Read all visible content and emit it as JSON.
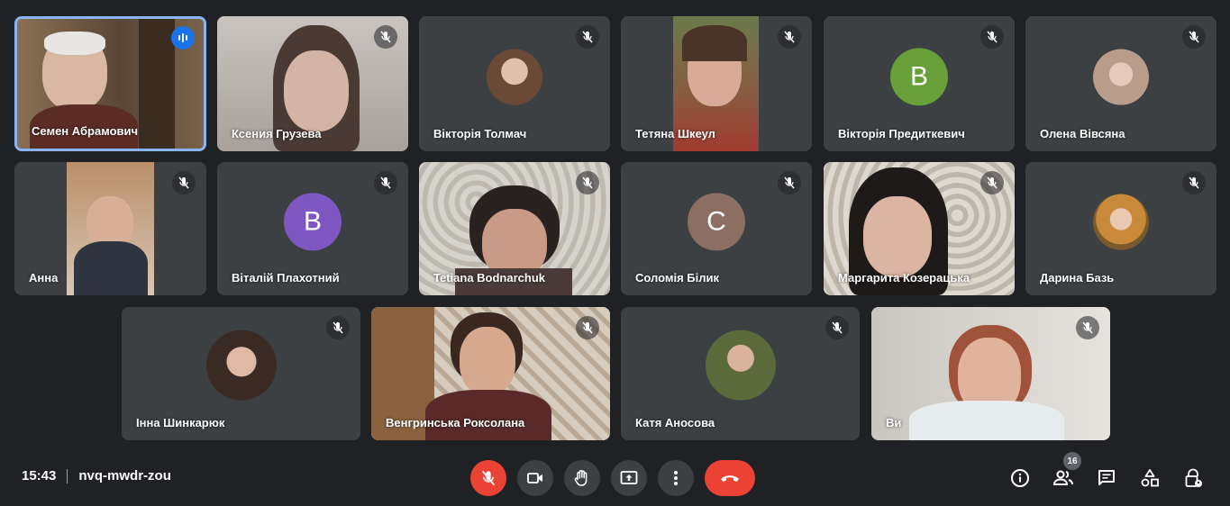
{
  "meeting": {
    "time": "15:43",
    "code": "nvq-mwdr-zou"
  },
  "participants_count": "16",
  "colors": {
    "active_border": "#8ab4f8",
    "end_call": "#ea4335",
    "tile_bg": "#3c4043"
  },
  "participants": [
    {
      "name": "Семен Абрамович",
      "speaking": true
    },
    {
      "name": "Ксения Грузева",
      "muted": true
    },
    {
      "name": "Вікторія Толмач",
      "muted": true
    },
    {
      "name": "Тетяна Шкеул",
      "muted": true
    },
    {
      "name": "Вікторія Предиткевич",
      "muted": true,
      "initial": "В",
      "avatar_color": "#689f38"
    },
    {
      "name": "Олена Вівсяна",
      "muted": true
    },
    {
      "name": "Анна",
      "muted": true
    },
    {
      "name": "Віталій Плахотний",
      "muted": true,
      "initial": "В",
      "avatar_color": "#7e57c2"
    },
    {
      "name": "Tetiana Bodnarchuk",
      "muted": true
    },
    {
      "name": "Соломія Білик",
      "muted": true,
      "initial": "С",
      "avatar_color": "#8d6e63"
    },
    {
      "name": "Маргарита Козерацька",
      "muted": true
    },
    {
      "name": "Дарина Базь",
      "muted": true
    },
    {
      "name": "Інна Шинкарюк",
      "muted": true
    },
    {
      "name": "Венгринська Роксолана",
      "muted": true
    },
    {
      "name": "Катя Аносова",
      "muted": true
    },
    {
      "name": "Ви",
      "muted": true
    }
  ]
}
